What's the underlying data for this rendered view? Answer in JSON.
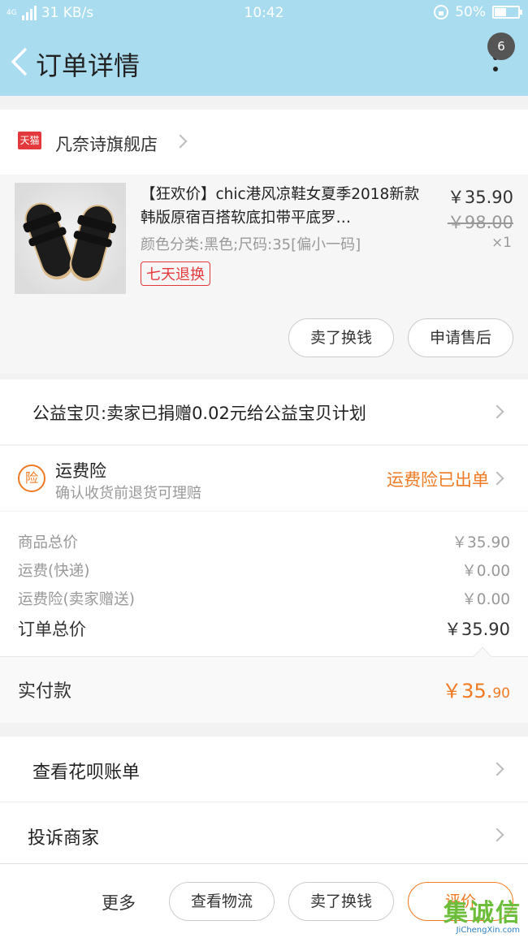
{
  "status_bar": {
    "network": "4G",
    "speed": "31 KB/s",
    "time": "10:42",
    "battery": "50%"
  },
  "header": {
    "title": "订单详情",
    "badge_count": "6"
  },
  "shop": {
    "badge": "天猫",
    "name": "凡奈诗旗舰店"
  },
  "product": {
    "title": "【狂欢价】chic港风凉鞋女夏季2018新款韩版原宿百搭软底扣带平底罗…",
    "spec": "颜色分类:黑色;尺码:35[偏小一码]",
    "tag": "七天退换",
    "price": "￥35.90",
    "original_price": "￥98.00",
    "quantity": "×1",
    "buttons": [
      "卖了换钱",
      "申请售后"
    ]
  },
  "charity": {
    "text": "公益宝贝:卖家已捐赠0.02元给公益宝贝计划"
  },
  "insurance": {
    "icon_text": "险",
    "title": "运费险",
    "subtitle": "确认收货前退货可理赔",
    "status": "运费险已出单"
  },
  "summary": {
    "rows": [
      {
        "label": "商品总价",
        "value": "￥35.90"
      },
      {
        "label": "运费(快递)",
        "value": "￥0.00"
      },
      {
        "label": "运费险(卖家赠送)",
        "value": "￥0.00"
      }
    ],
    "total_label": "订单总价",
    "total_value": "￥35.90"
  },
  "paid": {
    "label": "实付款",
    "value_main": "￥35.",
    "value_cents": "90"
  },
  "links": {
    "huabei": "查看花呗账单",
    "complain": "投诉商家"
  },
  "bottom_bar": {
    "more": "更多",
    "logistics": "查看物流",
    "resell": "卖了换钱",
    "review": "评价"
  },
  "watermark": {
    "main": "集诚信",
    "sub": "JiChengXin.com"
  },
  "colors": {
    "header_bg": "#a9dcef",
    "accent_orange": "#f07a23",
    "tmall_red": "#e4393c"
  }
}
